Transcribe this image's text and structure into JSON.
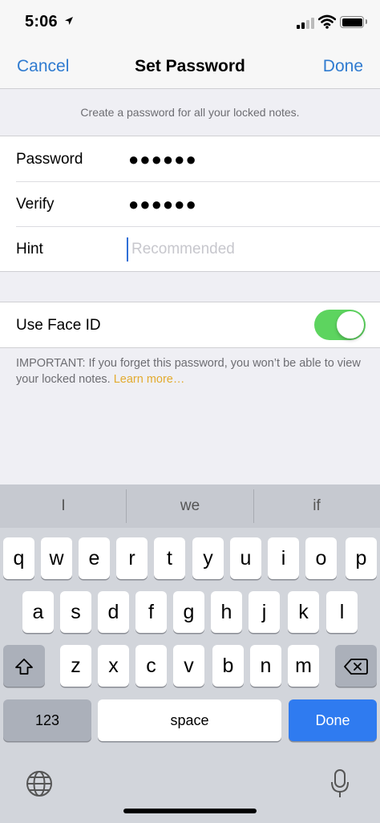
{
  "status": {
    "time": "5:06"
  },
  "nav": {
    "cancel": "Cancel",
    "title": "Set Password",
    "done": "Done"
  },
  "note": "Create a password for all your locked notes.",
  "form": {
    "password_label": "Password",
    "password_dots": "●●●●●●",
    "verify_label": "Verify",
    "verify_dots": "●●●●●●",
    "hint_label": "Hint",
    "hint_placeholder": "Recommended",
    "hint_value": ""
  },
  "faceid": {
    "label": "Use Face ID",
    "enabled": true
  },
  "important": {
    "text": "IMPORTANT: If you forget this password, you won’t be able to view your locked notes. ",
    "link": "Learn more…"
  },
  "keyboard": {
    "predictions": [
      "I",
      "we",
      "if"
    ],
    "row1": [
      "q",
      "w",
      "e",
      "r",
      "t",
      "y",
      "u",
      "i",
      "o",
      "p"
    ],
    "row2": [
      "a",
      "s",
      "d",
      "f",
      "g",
      "h",
      "j",
      "k",
      "l"
    ],
    "row3": [
      "z",
      "x",
      "c",
      "v",
      "b",
      "n",
      "m"
    ],
    "numbers_key": "123",
    "space_key": "space",
    "done_key": "Done"
  },
  "icons": {
    "shift": "shift-icon",
    "delete": "delete-icon",
    "globe": "globe-icon",
    "mic": "microphone-icon",
    "location": "location-arrow-icon"
  },
  "colors": {
    "accent": "#2f7bd0",
    "toggle_on": "#5dd45f",
    "link": "#e3ab2f",
    "done_key": "#2f7bf0"
  }
}
